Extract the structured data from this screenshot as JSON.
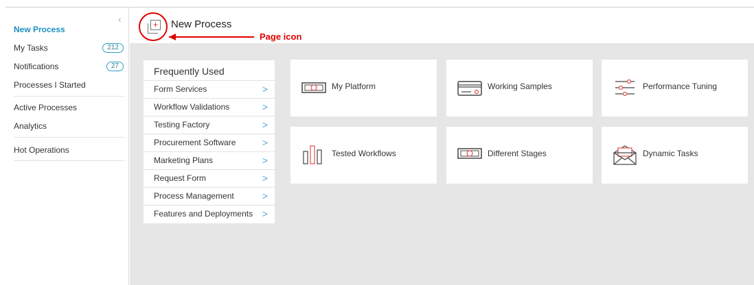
{
  "sidebar": {
    "collapse_glyph": "‹",
    "items": [
      {
        "label": "New Process",
        "active": true
      },
      {
        "label": "My Tasks",
        "badge": "212"
      },
      {
        "label": "Notifications",
        "badge": "27"
      },
      {
        "label": "Processes I Started"
      },
      {
        "label": "Active Processes"
      },
      {
        "label": "Analytics"
      },
      {
        "label": "Hot Operations"
      }
    ]
  },
  "header": {
    "title": "New Process",
    "page_icon": "page-add-icon"
  },
  "annotation": {
    "label": "Page icon",
    "color": "#e10000"
  },
  "frequently_used": {
    "title": "Frequently Used",
    "items": [
      "Form Services",
      "Workflow Validations",
      "Testing Factory",
      "Procurement Software",
      "Marketing Plans",
      "Request Form",
      "Process Management",
      "Features and Deployments"
    ]
  },
  "tiles": [
    {
      "label": "My Platform",
      "icon": "money-bill-icon"
    },
    {
      "label": "Working Samples",
      "icon": "card-icon"
    },
    {
      "label": "Performance Tuning",
      "icon": "sliders-icon"
    },
    {
      "label": "Tested Workflows",
      "icon": "bars-icon"
    },
    {
      "label": "Different Stages",
      "icon": "money-bill-icon"
    },
    {
      "label": "Dynamic Tasks",
      "icon": "envelope-icon"
    }
  ],
  "colors": {
    "accent": "#1c8fc0",
    "icon_red": "#e05050",
    "background": "#e6e6e6"
  }
}
